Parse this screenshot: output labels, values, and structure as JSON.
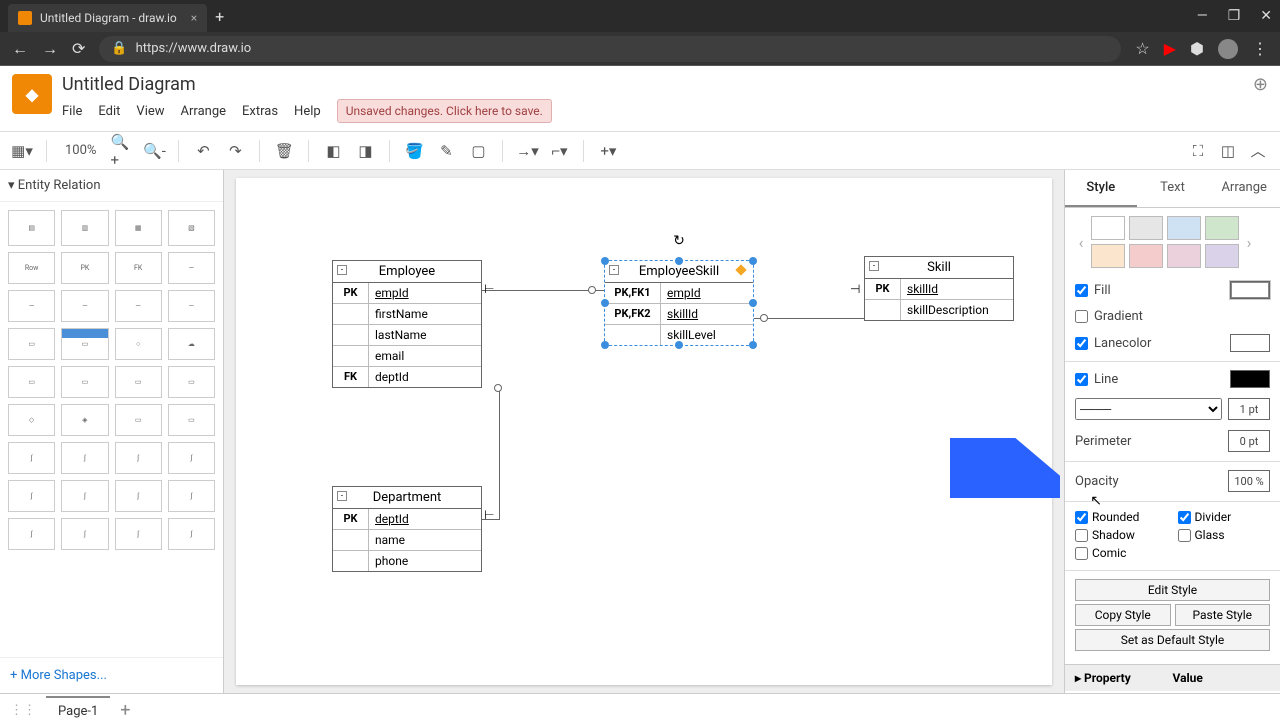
{
  "browser": {
    "tab_title": "Untitled Diagram - draw.io",
    "url": "https://www.draw.io"
  },
  "app": {
    "title": "Untitled Diagram",
    "menu": [
      "File",
      "Edit",
      "View",
      "Arrange",
      "Extras",
      "Help"
    ],
    "unsaved_msg": "Unsaved changes. Click here to save."
  },
  "toolbar": {
    "zoom": "100%"
  },
  "sidebar": {
    "category": "Entity Relation",
    "row_label": "Row",
    "more": "More Shapes..."
  },
  "canvas": {
    "entities": {
      "employee": {
        "name": "Employee",
        "rows": [
          {
            "k": "PK",
            "a": "empId"
          },
          {
            "k": "",
            "a": "firstName"
          },
          {
            "k": "",
            "a": "lastName"
          },
          {
            "k": "",
            "a": "email"
          },
          {
            "k": "FK",
            "a": "deptId"
          }
        ]
      },
      "employeeSkill": {
        "name": "EmployeeSkill",
        "rows": [
          {
            "k": "PK,FK1",
            "a": "empId"
          },
          {
            "k": "PK,FK2",
            "a": "skillId"
          },
          {
            "k": "",
            "a": "skillLevel"
          }
        ]
      },
      "skill": {
        "name": "Skill",
        "rows": [
          {
            "k": "PK",
            "a": "skillId"
          },
          {
            "k": "",
            "a": "skillDescription"
          }
        ]
      },
      "department": {
        "name": "Department",
        "rows": [
          {
            "k": "PK",
            "a": "deptId"
          },
          {
            "k": "",
            "a": "name"
          },
          {
            "k": "",
            "a": "phone"
          }
        ]
      }
    }
  },
  "right_panel": {
    "tabs": [
      "Style",
      "Text",
      "Arrange"
    ],
    "swatches_top": [
      "#ffffff",
      "#e6e6e6",
      "#cfe2f3",
      "#d0e6cc"
    ],
    "swatches_bot": [
      "#fce5cd",
      "#f4cccc",
      "#ead1dc",
      "#d9d2e9"
    ],
    "fill": "Fill",
    "fill_color": "#ffffff",
    "gradient": "Gradient",
    "lanecolor": "Lanecolor",
    "lanecolor_val": "#ffffff",
    "line": "Line",
    "line_color": "#000000",
    "line_width": "1 pt",
    "perimeter": "Perimeter",
    "perimeter_val": "0 pt",
    "opacity": "Opacity",
    "opacity_val": "100 %",
    "rounded": "Rounded",
    "divider": "Divider",
    "shadow": "Shadow",
    "glass": "Glass",
    "comic": "Comic",
    "edit_style": "Edit Style",
    "copy_style": "Copy Style",
    "paste_style": "Paste Style",
    "set_default": "Set as Default Style",
    "prop_header": "Property",
    "val_header": "Value"
  },
  "footer": {
    "page": "Page-1"
  }
}
